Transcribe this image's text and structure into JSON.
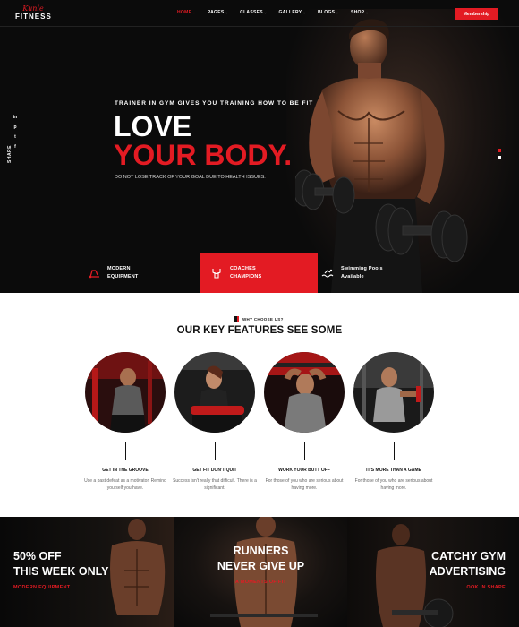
{
  "brand": {
    "script": "Kunle",
    "word": "FITNESS"
  },
  "nav": {
    "items": [
      {
        "label": "HOME"
      },
      {
        "label": "PAGES"
      },
      {
        "label": "CLASSES"
      },
      {
        "label": "GALLERY"
      },
      {
        "label": "BLOGS"
      },
      {
        "label": "SHOP"
      }
    ],
    "caret": "⌄",
    "membership": "Membership"
  },
  "social": {
    "icons": [
      "in",
      "p",
      "t",
      "f"
    ],
    "share": "SHARE"
  },
  "hero": {
    "tagline": "TRAINER IN GYM GIVES YOU TRAINING HOW TO BE FIT",
    "line1": "LOVE",
    "line2": "YOUR BODY.",
    "subtitle": "DO NOT LOSE TRACK OF YOUR GOAL DUE TO HEALTH ISSUES."
  },
  "feature_bar": [
    {
      "text": "MODERN\nEQUIPMENT",
      "icon": "treadmill-icon"
    },
    {
      "text": "COACHES\nCHAMPIONS",
      "icon": "coach-icon"
    },
    {
      "text": "Swimming Pools\nAvailable",
      "icon": "swimming-icon"
    }
  ],
  "why": {
    "eyebrow": "WHY CHOOSE US?",
    "title": "OUR KEY FEATURES SEE SOME",
    "cards": [
      {
        "title": "GET IN THE GROOVE",
        "text": "Use a past defeat as a motivator. Remind yourself you have."
      },
      {
        "title": "GET FIT DON'T QUIT",
        "text": "Success isn't really that difficult. There is a significant."
      },
      {
        "title": "WORK YOUR BUTT OFF",
        "text": "For those of you who are serious about having more."
      },
      {
        "title": "IT'S MORE THAN A GAME",
        "text": "For those of you who are serious about having more."
      }
    ]
  },
  "promo": [
    {
      "heading1": "50% OFF",
      "heading2": "THIS WEEK ONLY",
      "sub": "MODERN EQUIPMENT"
    },
    {
      "heading1": "RUNNERS",
      "heading2": "NEVER GIVE UP",
      "sub": "A MOMENTS OF FIT"
    },
    {
      "heading1": "CATCHY GYM",
      "heading2": "ADVERTISING",
      "sub": "LOOK IN SHAPE"
    }
  ],
  "colors": {
    "accent": "#e31b23",
    "dark": "#0b0b0b"
  }
}
